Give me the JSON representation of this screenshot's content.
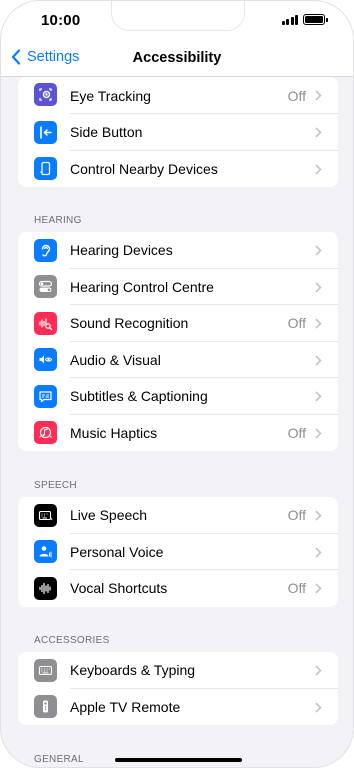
{
  "status_bar": {
    "time": "10:00"
  },
  "nav": {
    "back_label": "Settings",
    "title": "Accessibility"
  },
  "colors": {
    "accent": "#0a7cff",
    "eye_tracking_icon": "#5b55d6",
    "blue_icon": "#0a7cff",
    "gray_icon": "#8e8e93",
    "red_icon": "#ff2d55",
    "black_icon": "#000000"
  },
  "groups": {
    "top": {
      "items": [
        {
          "label": "Eye Tracking",
          "value": "Off",
          "icon": "eye-tracking-icon"
        },
        {
          "label": "Side Button",
          "value": "",
          "icon": "side-button-icon"
        },
        {
          "label": "Control Nearby Devices",
          "value": "",
          "icon": "nearby-devices-icon"
        }
      ]
    },
    "hearing": {
      "header": "HEARING",
      "items": [
        {
          "label": "Hearing Devices",
          "value": "",
          "icon": "ear-icon"
        },
        {
          "label": "Hearing Control Centre",
          "value": "",
          "icon": "toggles-icon"
        },
        {
          "label": "Sound Recognition",
          "value": "Off",
          "icon": "waveform-search-icon"
        },
        {
          "label": "Audio & Visual",
          "value": "",
          "icon": "speaker-eye-icon"
        },
        {
          "label": "Subtitles & Captioning",
          "value": "",
          "icon": "captions-icon"
        },
        {
          "label": "Music Haptics",
          "value": "Off",
          "icon": "music-haptics-icon"
        }
      ]
    },
    "speech": {
      "header": "SPEECH",
      "items": [
        {
          "label": "Live Speech",
          "value": "Off",
          "icon": "keyboard-speech-icon"
        },
        {
          "label": "Personal Voice",
          "value": "",
          "icon": "person-voice-icon"
        },
        {
          "label": "Vocal Shortcuts",
          "value": "Off",
          "icon": "waveform-icon"
        }
      ]
    },
    "accessories": {
      "header": "ACCESSORIES",
      "items": [
        {
          "label": "Keyboards & Typing",
          "value": "",
          "icon": "keyboard-icon"
        },
        {
          "label": "Apple TV Remote",
          "value": "",
          "icon": "remote-icon"
        }
      ]
    },
    "general": {
      "header": "GENERAL"
    }
  }
}
